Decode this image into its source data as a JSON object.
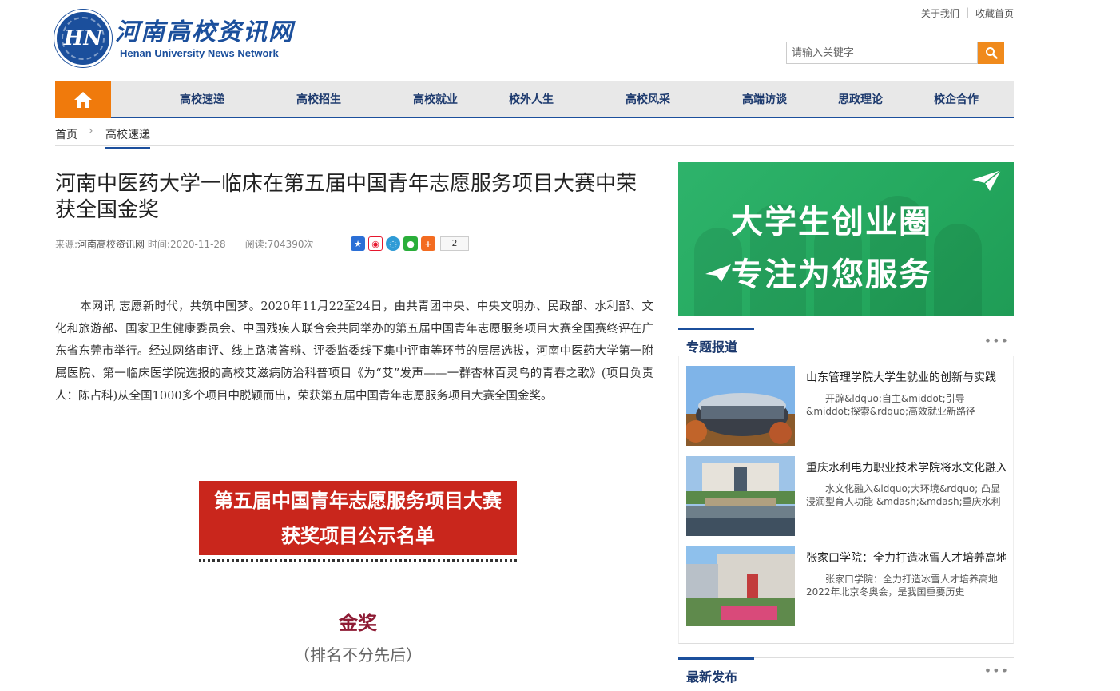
{
  "header": {
    "logo_mark": "HN",
    "logo_cn": "河南高校资讯网",
    "logo_en": "Henan University News Network",
    "links": [
      "关于我们",
      "收藏首页"
    ],
    "link_sep": "|",
    "search_placeholder": "请输入关键字"
  },
  "nav": {
    "items": [
      "高校速递",
      "高校招生",
      "高校就业",
      "校外人生",
      "高校风采",
      "高端访谈",
      "思政理论",
      "校企合作"
    ]
  },
  "breadcrumb": {
    "home": "首页",
    "arrow": "›",
    "current": "高校速递"
  },
  "article": {
    "title": "河南中医药大学一临床在第五届中国青年志愿服务项目大赛中荣获全国金奖",
    "source_label": "来源:",
    "source": "河南高校资讯网",
    "time_label": "时间:",
    "date": "2020-11-28",
    "reads_label": "阅读:",
    "reads": "704390次",
    "share_count": "2",
    "body": "本网讯 志愿新时代，共筑中国梦。2020年11月22至24日，由共青团中央、中央文明办、民政部、水利部、文化和旅游部、国家卫生健康委员会、中国残疾人联合会共同举办的第五届中国青年志愿服务项目大赛全国赛终评在广东省东莞市举行。经过网络审评、线上路演答辩、评委监委线下集中评审等环节的层层选拔，河南中医药大学第一附属医院、第一临床医学院选报的高校艾滋病防治科普项目《为“艾”发声——一群杏林百灵鸟的青春之歌》(项目负责人：陈占科)从全国1000多个项目中脱颖而出，荣获第五届中国青年志愿服务项目大赛全国金奖。",
    "banner_line1": "第五届中国青年志愿服务项目大赛",
    "banner_line2": "获奖项目公示名单",
    "gold": "金奖",
    "gold_sub": "（排名不分先后）"
  },
  "ad": {
    "line1": "大学生创业圈",
    "line2": "专注为您服务"
  },
  "special": {
    "title": "专题报道",
    "more": "•••",
    "items": [
      {
        "title": "山东管理学院大学生就业的创新与实践",
        "desc": "开辟&ldquo;自主&middot;引导&middot;探索&rdquo;高效就业新路径"
      },
      {
        "title": "重庆水利电力职业技术学院将水文化融入",
        "desc": "水文化融入&ldquo;大环境&rdquo; 凸显浸润型育人功能 &mdash;&mdash;重庆水利"
      },
      {
        "title": "张家口学院：全力打造冰雪人才培养高地",
        "desc": "张家口学院：全力打造冰雪人才培养高地　　2022年北京冬奥会，是我国重要历史"
      }
    ]
  },
  "latest": {
    "title": "最新发布",
    "more": "•••"
  },
  "colors": {
    "brand_blue": "#1b4f9c",
    "accent_orange": "#f07a0c",
    "ad_green": "#2eb36b",
    "banner_red": "#c9261c"
  }
}
